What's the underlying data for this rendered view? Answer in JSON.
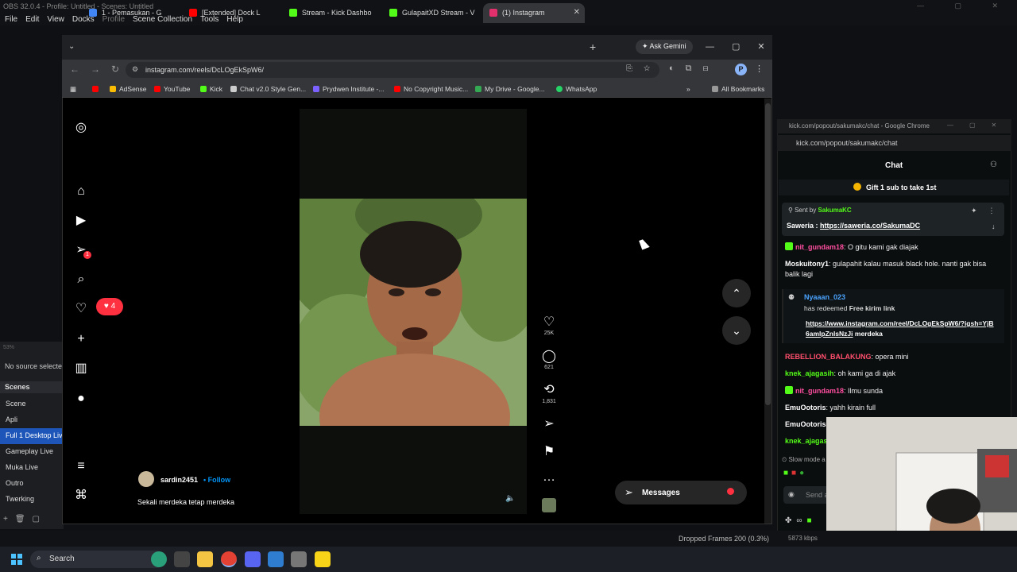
{
  "obs": {
    "title": "OBS 32.0.4 - Profile: Untitled - Scenes: Untitled",
    "menu": [
      "File",
      "Edit",
      "View",
      "Docks",
      "Profile",
      "Scene Collection",
      "Tools",
      "Help"
    ],
    "zoom": "53%",
    "no_source": "No source selected",
    "scenes_header": "Scenes",
    "scenes": [
      "Scene",
      "Apli",
      "Full 1 Desktop Live",
      "Gameplay Live",
      "Muka Live",
      "Outro",
      "Twerking"
    ],
    "active_scene_index": 2,
    "dropped_frames": "Dropped Frames 200 (0.3%)",
    "kbps": "5873 kbps"
  },
  "chrome": {
    "tabs": [
      {
        "label": "1 - Pemasukan - G",
        "color": "#4285f4"
      },
      {
        "label": "[Extended] Dock L",
        "color": "#ff0000"
      },
      {
        "label": "Stream - Kick Dashbo",
        "color": "#53fc18"
      },
      {
        "label": "GulapaitXD Stream - V",
        "color": "#53fc18"
      },
      {
        "label": "(1) Instagram",
        "color": "#e1306c"
      }
    ],
    "ask_gemini": "Ask Gemini",
    "url": "instagram.com/reels/DcLOgEkSpW6/",
    "bookmarks": [
      {
        "label": "",
        "color": "#ff0000"
      },
      {
        "label": "AdSense",
        "color": "#fbbc04"
      },
      {
        "label": "YouTube",
        "color": "#ff0000"
      },
      {
        "label": "Kick",
        "color": "#53fc18"
      },
      {
        "label": "Chat v2.0 Style Gen...",
        "color": "#cccccc"
      },
      {
        "label": "Prydwen Institute -...",
        "color": "#7b61ff"
      },
      {
        "label": "No Copyright Music...",
        "color": "#ff0000"
      },
      {
        "label": "My Drive - Google...",
        "color": "#34a853"
      },
      {
        "label": "WhatsApp",
        "color": "#25d366"
      }
    ],
    "all_bookmarks": "All Bookmarks",
    "profile_initial": "P"
  },
  "instagram": {
    "message_badge": "1",
    "notifications": "4",
    "likes": "25K",
    "comments": "621",
    "shares": "1,831",
    "username": "sardin2451",
    "follow": "• Follow",
    "caption": "Sekali merdeka tetap merdeka",
    "messages_label": "Messages"
  },
  "kick": {
    "window_title": "kick.com/popout/sakumakc/chat - Google Chrome",
    "url": "kick.com/popout/sakumakc/chat",
    "chat_header": "Chat",
    "gift_banner": "Gift 1 sub to take 1st",
    "pinned_by_label": "Sent by",
    "pinned_by_user": "SakumaKC",
    "pinned_prefix": "Saweria :",
    "pinned_link": "https://saweria.co/SakumaDC",
    "messages": [
      {
        "user": "nit_gundam18",
        "color": "#ff4fa0",
        "text": "O gitu kami gak diajak",
        "badge": true
      },
      {
        "user": "Moskuitony1",
        "color": "#ffffff",
        "text": "gulapahit kalau masuk black hole. nanti gak bisa balik lagi",
        "badge": false
      }
    ],
    "redeem": {
      "user": "Nyaaan_023",
      "text_prefix": "has redeemed",
      "reward": "Free kirim link",
      "link": "https://www.instagram.com/reel/DcLOgEkSpW6/?igsh=YjB6amlpZnlsNzJi",
      "suffix": "merdeka"
    },
    "messages2": [
      {
        "user": "REBELLION_BALAKUNG",
        "color": "#ff4f6d",
        "text": "opera mini",
        "badge": false
      },
      {
        "user": "knek_ajagasih",
        "color": "#53fc18",
        "text": "oh kami ga di ajak",
        "badge": false
      },
      {
        "user": "nit_gundam18",
        "color": "#ff4fa0",
        "text": "Ilmu sunda",
        "badge": true
      },
      {
        "user": "EmuOotoris",
        "color": "#ffffff",
        "text": "yahh kirain full",
        "badge": false
      },
      {
        "user": "EmuOotoris",
        "color": "#ffffff",
        "text": "",
        "badge": false
      },
      {
        "user": "knek_ajagas",
        "color": "#53fc18",
        "text": "",
        "badge": false
      }
    ],
    "slow_mode": "Slow mode a",
    "input_placeholder": "Send a"
  },
  "taskbar": {
    "search": "Search"
  }
}
